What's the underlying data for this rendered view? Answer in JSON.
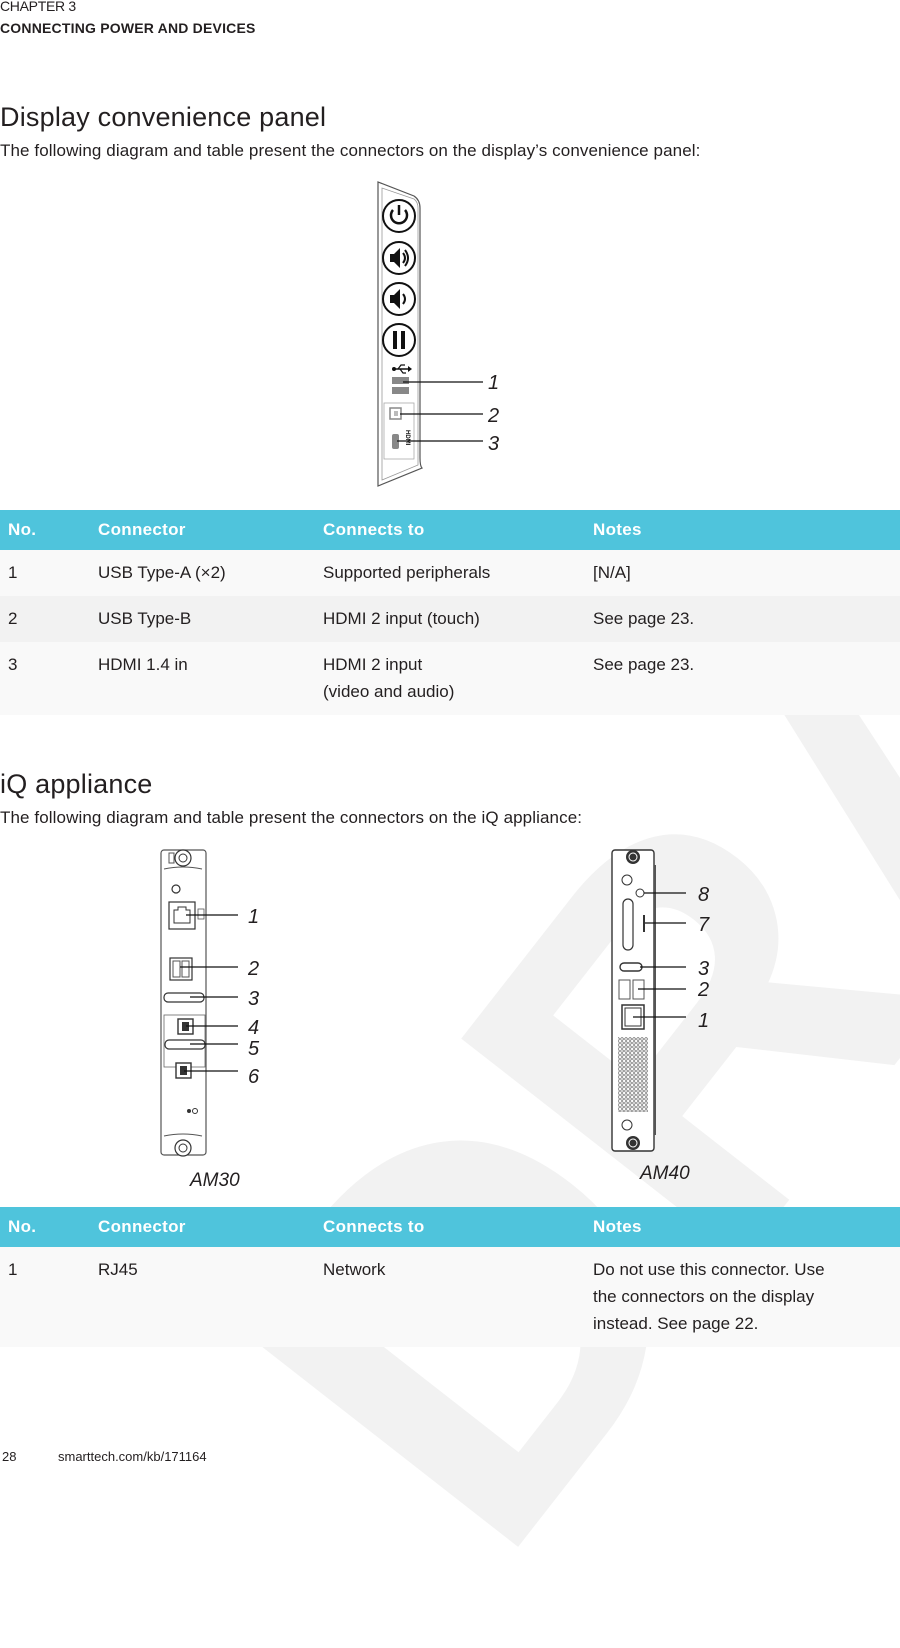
{
  "header": {
    "chapter_label": "CHAPTER 3",
    "chapter_title": "CONNECTING POWER AND DEVICES"
  },
  "watermark": "DRAFT",
  "section_display": {
    "title": "Display convenience panel",
    "intro": "The following diagram and table present the connectors on the display’s convenience panel:",
    "diagram": {
      "buttons": [
        "power-icon",
        "volume-up-icon",
        "volume-down-icon",
        "pause-icon"
      ],
      "callouts": [
        "1",
        "2",
        "3"
      ],
      "usb_symbol": "usb-icon",
      "hdmi_label": "HDMI"
    },
    "table": {
      "headers": [
        "No.",
        "Connector",
        "Connects to",
        "Notes"
      ],
      "rows": [
        {
          "no": "1",
          "connector": "USB Type-A (×2)",
          "connects_to": "Supported peripherals",
          "connects_to_2": "",
          "notes": "[N/A]"
        },
        {
          "no": "2",
          "connector": "USB Type-B",
          "connects_to": "HDMI 2 input (touch)",
          "connects_to_2": "",
          "notes": "See page 23."
        },
        {
          "no": "3",
          "connector": "HDMI 1.4 in",
          "connects_to": "HDMI 2 input",
          "connects_to_2": "(video and audio)",
          "notes": "See page 23."
        }
      ]
    }
  },
  "section_iq": {
    "title": "iQ appliance",
    "intro": "The following diagram and table present the connectors on the iQ appliance:",
    "diagrams": [
      {
        "model": "AM30",
        "callouts": [
          "1",
          "2",
          "3",
          "4",
          "5",
          "6"
        ]
      },
      {
        "model": "AM40",
        "callouts": [
          "8",
          "7",
          "3",
          "2",
          "1"
        ]
      }
    ],
    "table": {
      "headers": [
        "No.",
        "Connector",
        "Connects to",
        "Notes"
      ],
      "rows": [
        {
          "no": "1",
          "connector": "RJ45",
          "connects_to": "Network",
          "notes_lines": [
            "Do not use this connector. Use",
            "the connectors on the display",
            "instead. See page 22."
          ]
        }
      ]
    }
  },
  "footer": {
    "page_number": "28",
    "url": "smarttech.com/kb/171164"
  },
  "colors": {
    "table_header": "#4fc4dc",
    "text": "#231f20",
    "row_light": "#f9f9f9",
    "row_alt": "#f2f2f2"
  }
}
